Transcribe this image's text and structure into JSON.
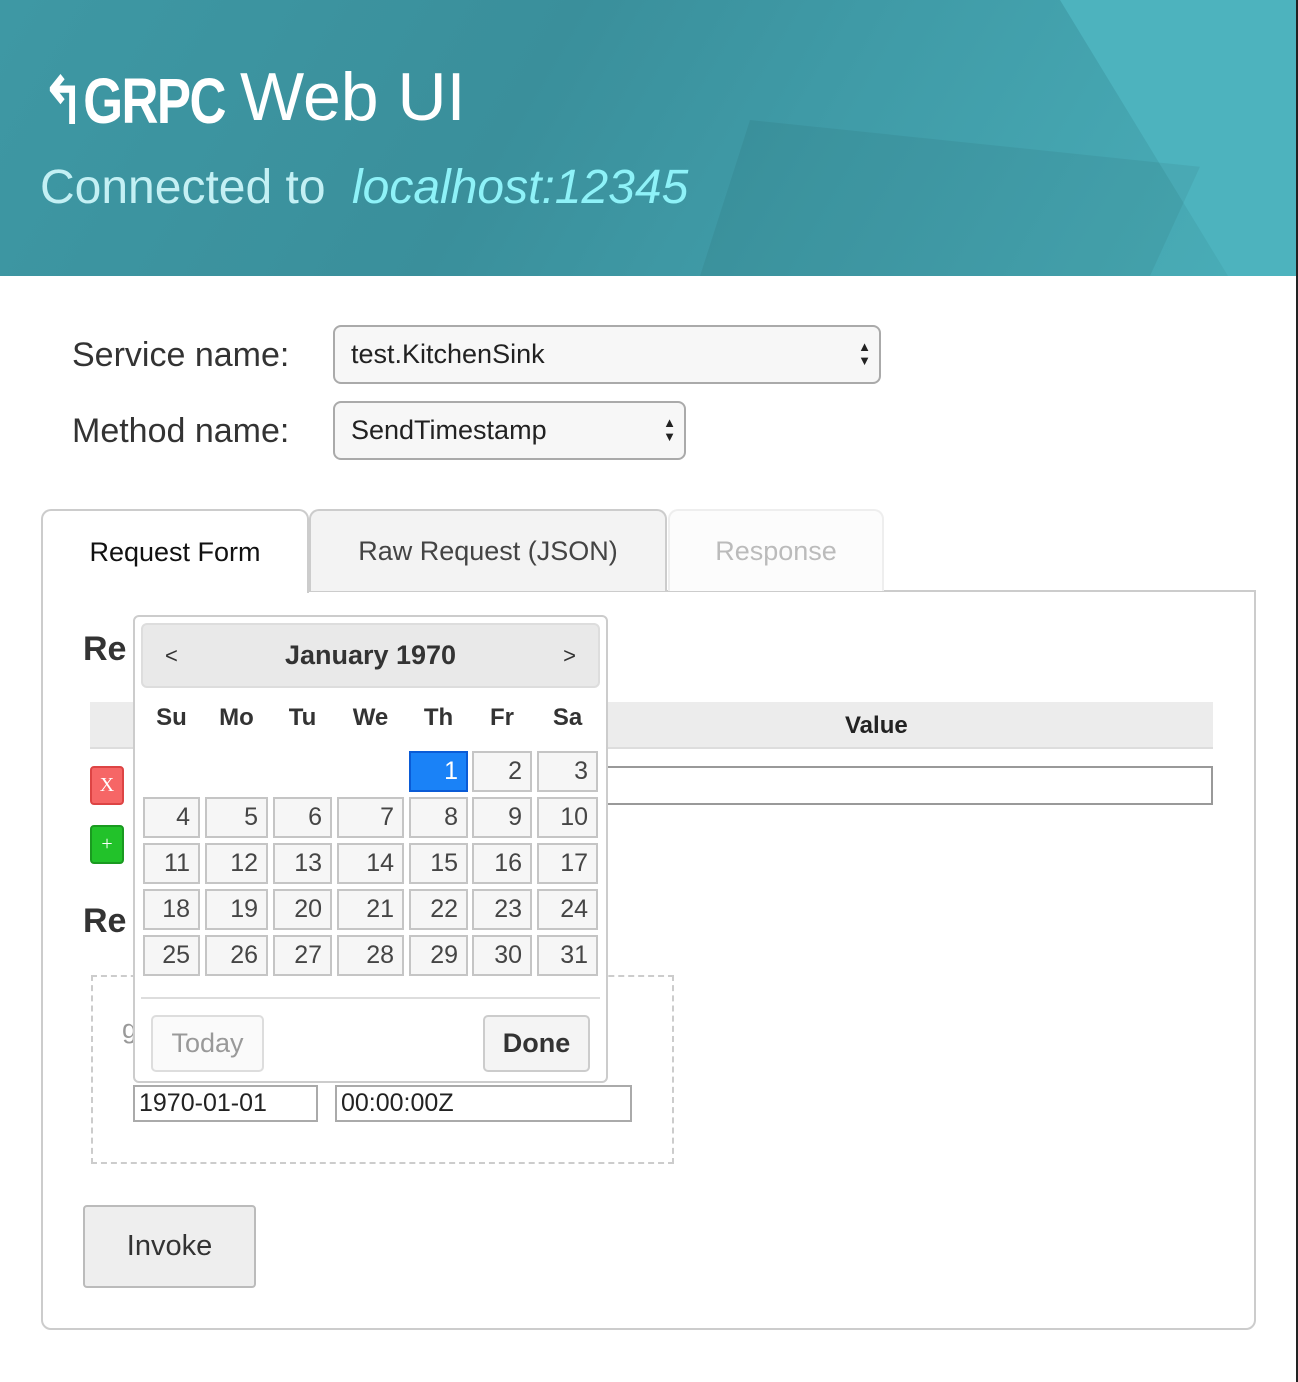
{
  "header": {
    "logo_text": "GRPC",
    "title": "Web UI",
    "connected_label": "Connected to",
    "host": "localhost:12345"
  },
  "form": {
    "service_label": "Service name:",
    "service_value": "test.KitchenSink",
    "method_label": "Method name:",
    "method_value": "SendTimestamp"
  },
  "tabs": [
    {
      "label": "Request Form",
      "state": "active"
    },
    {
      "label": "Raw Request (JSON)",
      "state": "inactive"
    },
    {
      "label": "Response",
      "state": "disabled"
    }
  ],
  "panel": {
    "heading1_partial": "Re",
    "heading2_partial": "Re",
    "value_header": "Value",
    "remove_label": "X",
    "add_label": "+",
    "field_label_partial": "g",
    "date_value": "1970-01-01",
    "time_value": "00:00:00Z",
    "invoke_label": "Invoke"
  },
  "datepicker": {
    "month": "January 1970",
    "prev": "<",
    "next": ">",
    "weekdays": [
      "Su",
      "Mo",
      "Tu",
      "We",
      "Th",
      "Fr",
      "Sa"
    ],
    "weeks": [
      [
        null,
        null,
        null,
        null,
        1,
        2,
        3
      ],
      [
        4,
        5,
        6,
        7,
        8,
        9,
        10
      ],
      [
        11,
        12,
        13,
        14,
        15,
        16,
        17
      ],
      [
        18,
        19,
        20,
        21,
        22,
        23,
        24
      ],
      [
        25,
        26,
        27,
        28,
        29,
        30,
        31
      ]
    ],
    "selected": 1,
    "today_label": "Today",
    "done_label": "Done"
  },
  "colors": {
    "header": "#3f9aa6",
    "selected_day": "#1a82f7",
    "remove": "#f66666",
    "add": "#22c22a"
  }
}
